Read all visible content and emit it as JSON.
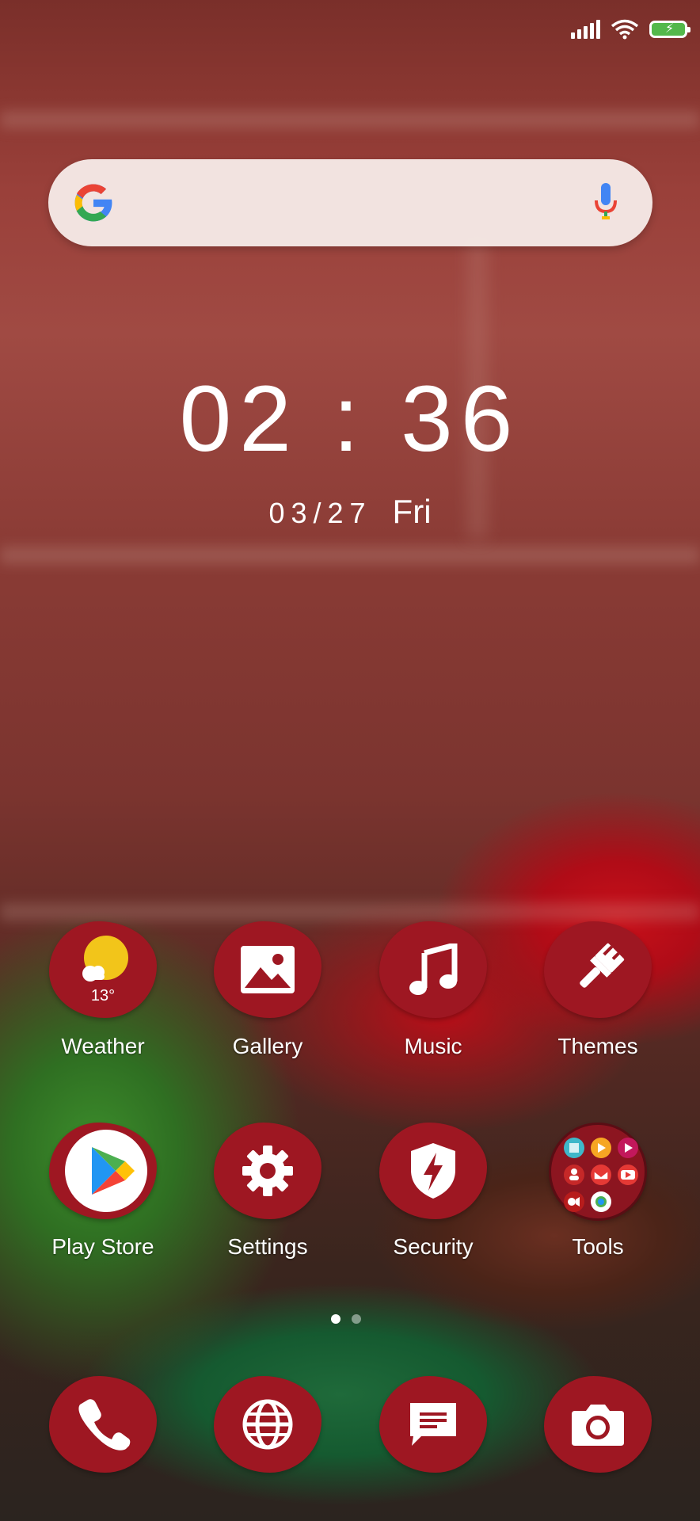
{
  "clock": {
    "time": "02 : 36",
    "date": "03/27",
    "day": "Fri"
  },
  "search": {
    "logo": "google-g-icon",
    "mic": "microphone-icon"
  },
  "weather": {
    "temp": "13°"
  },
  "apps_row1": [
    {
      "label": "Weather",
      "icon": "weather-sun-icon"
    },
    {
      "label": "Gallery",
      "icon": "gallery-image-icon"
    },
    {
      "label": "Music",
      "icon": "music-note-icon"
    },
    {
      "label": "Themes",
      "icon": "paint-brush-icon"
    }
  ],
  "apps_row2": [
    {
      "label": "Play Store",
      "icon": "play-store-icon"
    },
    {
      "label": "Settings",
      "icon": "gear-icon"
    },
    {
      "label": "Security",
      "icon": "shield-bolt-icon"
    },
    {
      "label": "Tools",
      "icon": "folder-icon"
    }
  ],
  "dock": [
    {
      "icon": "phone-icon"
    },
    {
      "icon": "globe-icon"
    },
    {
      "icon": "messages-icon"
    },
    {
      "icon": "camera-icon"
    }
  ],
  "page_indicator": {
    "pages": 2,
    "current": 1
  },
  "colors": {
    "icon_bg": "#9e1722",
    "accent_green": "#53b84b"
  }
}
